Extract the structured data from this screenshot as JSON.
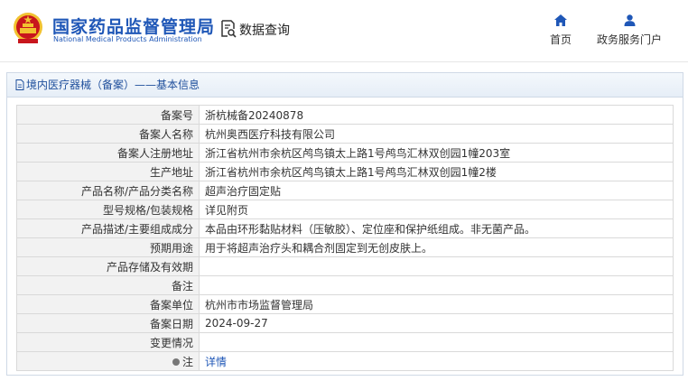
{
  "header": {
    "brand_cn": "国家药品监督管理局",
    "brand_en": "National Medical Products Administration",
    "query_label": "数据查询",
    "nav": [
      {
        "label": "首页",
        "icon": "home-icon"
      },
      {
        "label": "政务服务门户",
        "icon": "user-icon"
      }
    ]
  },
  "panel": {
    "title": "境内医疗器械（备案）——基本信息"
  },
  "rows": [
    {
      "label": "备案号",
      "value": "浙杭械备20240878"
    },
    {
      "label": "备案人名称",
      "value": "杭州奥西医疗科技有限公司"
    },
    {
      "label": "备案人注册地址",
      "value": "浙江省杭州市余杭区鸬鸟镇太上路1号鸬鸟汇林双创园1幢203室"
    },
    {
      "label": "生产地址",
      "value": "浙江省杭州市余杭区鸬鸟镇太上路1号鸬鸟汇林双创园1幢2楼"
    },
    {
      "label": "产品名称/产品分类名称",
      "value": "超声治疗固定贴"
    },
    {
      "label": "型号规格/包装规格",
      "value": "详见附页"
    },
    {
      "label": "产品描述/主要组成成分",
      "value": "本品由环形黏贴材料（压敏胶）、定位座和保护纸组成。非无菌产品。"
    },
    {
      "label": "预期用途",
      "value": "用于将超声治疗头和耦合剂固定到无创皮肤上。"
    },
    {
      "label": "产品存储及有效期",
      "value": ""
    },
    {
      "label": "备注",
      "value": ""
    },
    {
      "label": "备案单位",
      "value": "杭州市市场监督管理局"
    },
    {
      "label": "备案日期",
      "value": "2024-09-27"
    },
    {
      "label": "变更情况",
      "value": ""
    }
  ],
  "note_row": {
    "label": "注",
    "link": "详情"
  },
  "colors": {
    "brand_blue": "#1f57b7",
    "emblem_red": "#c8161d",
    "emblem_gold": "#f2c230"
  }
}
